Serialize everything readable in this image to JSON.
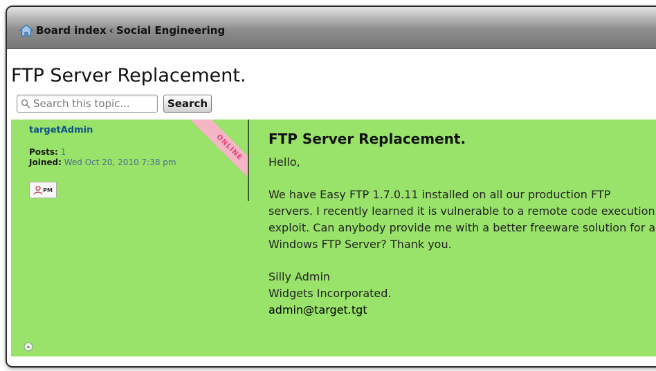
{
  "breadcrumb": {
    "home": "Board index",
    "separator": "‹",
    "forum": "Social Engineering"
  },
  "topic": {
    "title": "FTP Server Replacement."
  },
  "search": {
    "placeholder": "Search this topic...",
    "button_label": "Search"
  },
  "post": {
    "author": "targetAdmin",
    "status_ribbon": "ONLINE",
    "posts_label": "Posts:",
    "posts_value": "1",
    "joined_label": "Joined:",
    "joined_value": "Wed Oct 20, 2010 7:38 pm",
    "pm_label": "PM",
    "subject": "FTP Server Replacement.",
    "greeting": "Hello,",
    "body": "We have Easy FTP 1.7.0.11 installed on all our production FTP servers. I recently learned it is vulnerable to a remote code execution exploit. Can anybody provide me with a better freeware solution for a Windows FTP Server? Thank you.",
    "signature_name": "Silly Admin",
    "signature_company": "Widgets Incorporated.",
    "signature_email": "admin@target.tgt"
  },
  "colors": {
    "post_background": "#99e36b",
    "author_link": "#105289",
    "online_ribbon": "#f4b6c4",
    "online_text": "#e0457b"
  },
  "icons": {
    "home": "home-icon",
    "search": "magnifier-icon",
    "pm": "pm-user-icon",
    "back_to_top": "up-arrow-icon"
  }
}
